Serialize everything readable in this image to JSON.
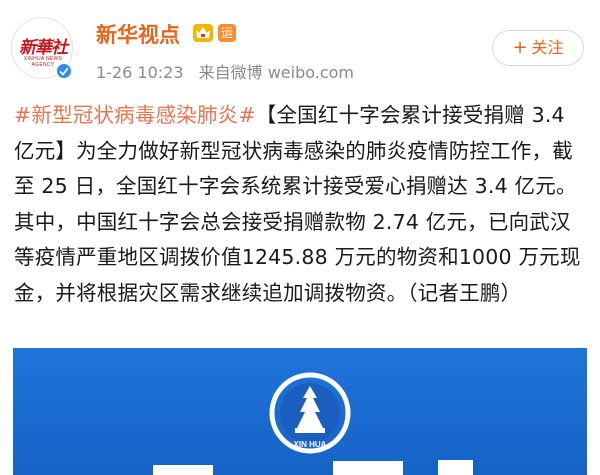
{
  "account": {
    "name": "新华视点",
    "avatar_logo_text": "新華社",
    "avatar_sub_text": "XINHUA NEWS AGENCY",
    "badge_yun": "运"
  },
  "meta": {
    "time": "1-26 10:23",
    "source": "来自微博 weibo.com"
  },
  "follow": {
    "plus": "+",
    "label": "关注"
  },
  "post": {
    "hashtag": "#新型冠状病毒感染肺炎#",
    "body": "【全国红十字会累计接受捐赠 3.4 亿元】为全力做好新型冠状病毒感染的肺炎疫情防控工作，截至 25 日，全国红十字会系统累计接受爱心捐赠达 3.4 亿元。其中，中国红十字会总会接受捐赠款物 2.74 亿元，已向武汉等疫情严重地区调拨价值1245.88 万元的物资和1000 万元现金，并将根据灾区需求继续追加调拨物资。（记者王鹏）"
  },
  "image": {
    "emblem_text": "XIN HUA"
  },
  "colors": {
    "name_orange": "#e8641b",
    "hashtag": "#eb7350",
    "verified_blue": "#2c8ae8",
    "image_blue": "#1a6ad0",
    "logo_red": "#c8161d"
  }
}
